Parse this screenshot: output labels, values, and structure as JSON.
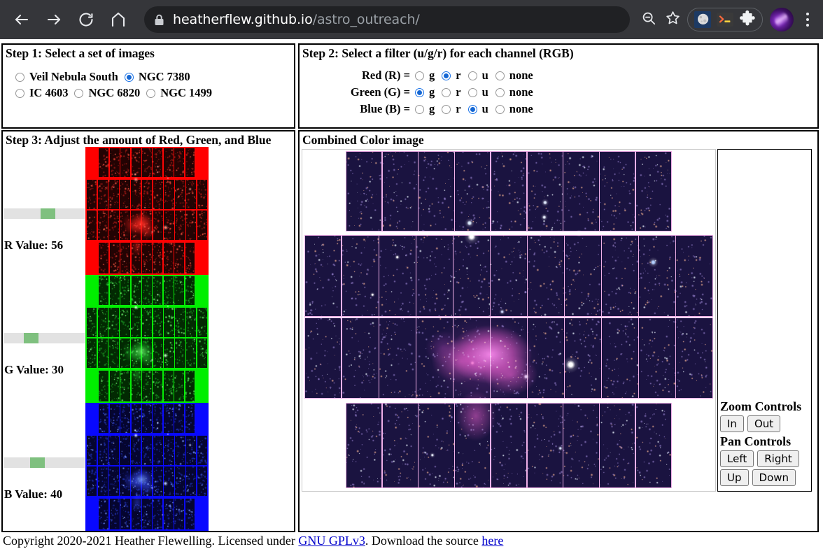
{
  "browser": {
    "back_icon": "arrow-left-icon",
    "forward_icon": "arrow-right-icon",
    "reload_icon": "reload-icon",
    "home_icon": "home-icon",
    "lock_icon": "lock-icon",
    "url_domain": "heatherflew.github.io",
    "url_path": "/astro_outreach/",
    "zoom_icon": "zoom-out-icon",
    "bookmark_icon": "star-icon",
    "extensions": [
      {
        "name": "moon-extension-icon"
      },
      {
        "name": "terminal-extension-icon"
      },
      {
        "name": "puzzle-extension-icon"
      }
    ],
    "avatar_name": "profile-avatar",
    "menu_icon": "three-dot-menu-icon"
  },
  "step1": {
    "title": "Step 1: Select a set of images",
    "options": [
      {
        "label": "Veil Nebula South",
        "checked": false
      },
      {
        "label": "NGC 7380",
        "checked": true
      },
      {
        "label": "IC 4603",
        "checked": false
      },
      {
        "label": "NGC 6820",
        "checked": false
      },
      {
        "label": "NGC 1499",
        "checked": false
      }
    ]
  },
  "step2": {
    "title": "Step 2: Select a filter (u/g/r) for each channel (RGB)",
    "filters": [
      "g",
      "r",
      "u",
      "none"
    ],
    "channels": [
      {
        "label": "Red (R) =",
        "selected": "r"
      },
      {
        "label": "Green (G) =",
        "selected": "g"
      },
      {
        "label": "Blue (B) =",
        "selected": "u"
      }
    ]
  },
  "step3": {
    "title": "Step 3: Adjust the amount of Red, Green, and Blue",
    "sliders": [
      {
        "label": "R Value: 56",
        "value": 56,
        "min": 0,
        "max": 100,
        "channel": "red",
        "color": "#ff0000"
      },
      {
        "label": "G Value: 30",
        "value": 30,
        "min": 0,
        "max": 100,
        "channel": "green",
        "color": "#00ee00"
      },
      {
        "label": "B Value: 40",
        "value": 40,
        "min": 0,
        "max": 100,
        "channel": "blue",
        "color": "#0000ff"
      }
    ]
  },
  "combined": {
    "title": "Combined Color image",
    "zoom_title": "Zoom Controls",
    "zoom_buttons": [
      "In",
      "Out"
    ],
    "pan_title": "Pan Controls",
    "pan_buttons_row1": [
      "Left",
      "Right"
    ],
    "pan_buttons_row2": [
      "Up",
      "Down"
    ]
  },
  "footer": {
    "text_before": "Copyright 2020-2021 Heather Flewelling. Licensed under ",
    "license_link": "GNU GPLv3",
    "text_middle": ". Download the source ",
    "source_link": "here"
  },
  "mosaic": {
    "rows": [
      {
        "tiles": 9,
        "inset": true
      },
      {
        "tiles": 11,
        "inset": false
      },
      {
        "tiles": 11,
        "inset": false
      },
      {
        "tiles": 9,
        "inset": true
      }
    ],
    "grid_line_color": "#f0b0e8",
    "sky_color": "#1b1440",
    "nebula_color": "#ff6ad5"
  }
}
